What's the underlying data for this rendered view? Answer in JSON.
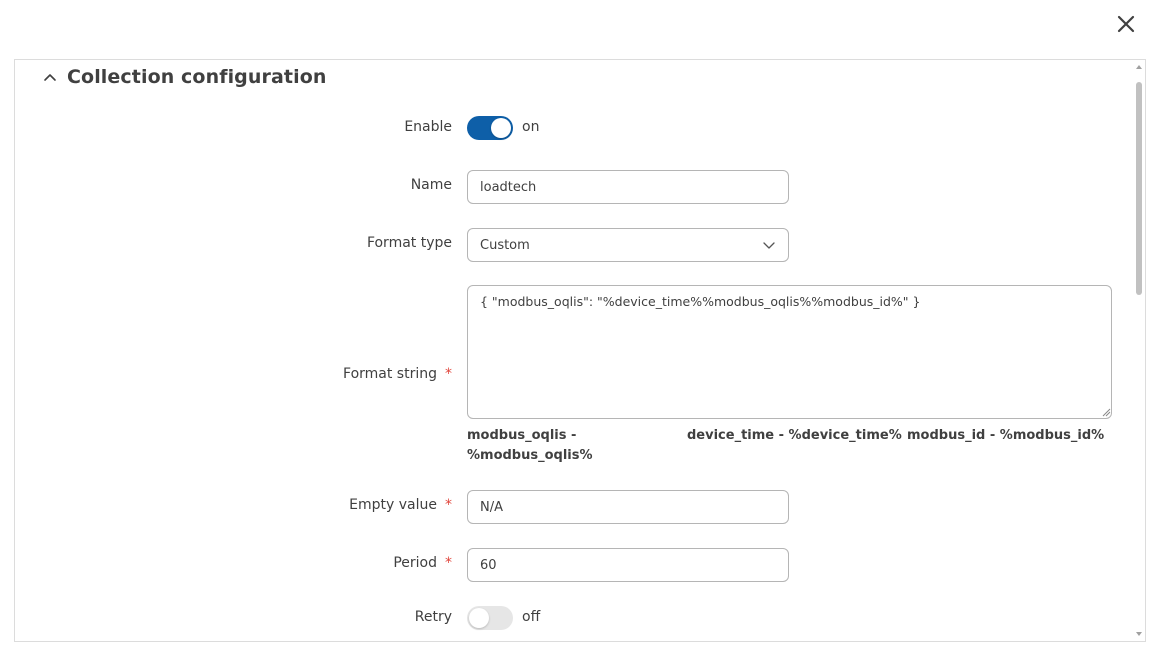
{
  "dialog": {
    "close_icon": "close-icon"
  },
  "section": {
    "title": "Collection configuration",
    "collapse_icon": "chevron-up-icon"
  },
  "fields": {
    "enable": {
      "label": "Enable",
      "state": "on"
    },
    "name": {
      "label": "Name",
      "value": "loadtech"
    },
    "format_type": {
      "label": "Format type",
      "value": "Custom"
    },
    "format_string": {
      "label": "Format string",
      "required": "*",
      "value": "{ \"modbus_oqlis\": \"%device_time%%modbus_oqlis%%modbus_id%\" }"
    },
    "hints": {
      "modbus_oqlis_line1": "modbus_oqlis -",
      "modbus_oqlis_line2": "%modbus_oqlis%",
      "device_time": "device_time - %device_time%",
      "modbus_id": "modbus_id - %modbus_id%"
    },
    "empty_value": {
      "label": "Empty value",
      "required": "*",
      "value": "N/A"
    },
    "period": {
      "label": "Period",
      "required": "*",
      "value": "60"
    },
    "retry": {
      "label": "Retry",
      "state": "off"
    }
  },
  "colors": {
    "accent": "#0e5fa8",
    "required": "#e0433a",
    "border": "#b5b5b5"
  }
}
